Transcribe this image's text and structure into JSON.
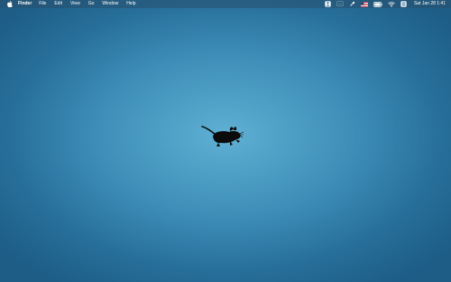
{
  "menubar": {
    "apple_icon": "apple-icon",
    "app_name": "Finder",
    "menus": [
      "File",
      "Edit",
      "View",
      "Go",
      "Window",
      "Help"
    ],
    "status_icons": [
      "share-box-icon",
      "screen-mirror-icon",
      "mic-pen-icon",
      "us-flag-input-icon",
      "battery-icon",
      "wifi-icon",
      "control-center-icon"
    ],
    "clock": "Sat Jan 28  1:41"
  },
  "desktop": {
    "wallpaper_logo": "xfce-mouse-icon",
    "colors": {
      "center": "#5fb0d3",
      "mid": "#3d8db8",
      "edge": "#1d5d86"
    }
  }
}
